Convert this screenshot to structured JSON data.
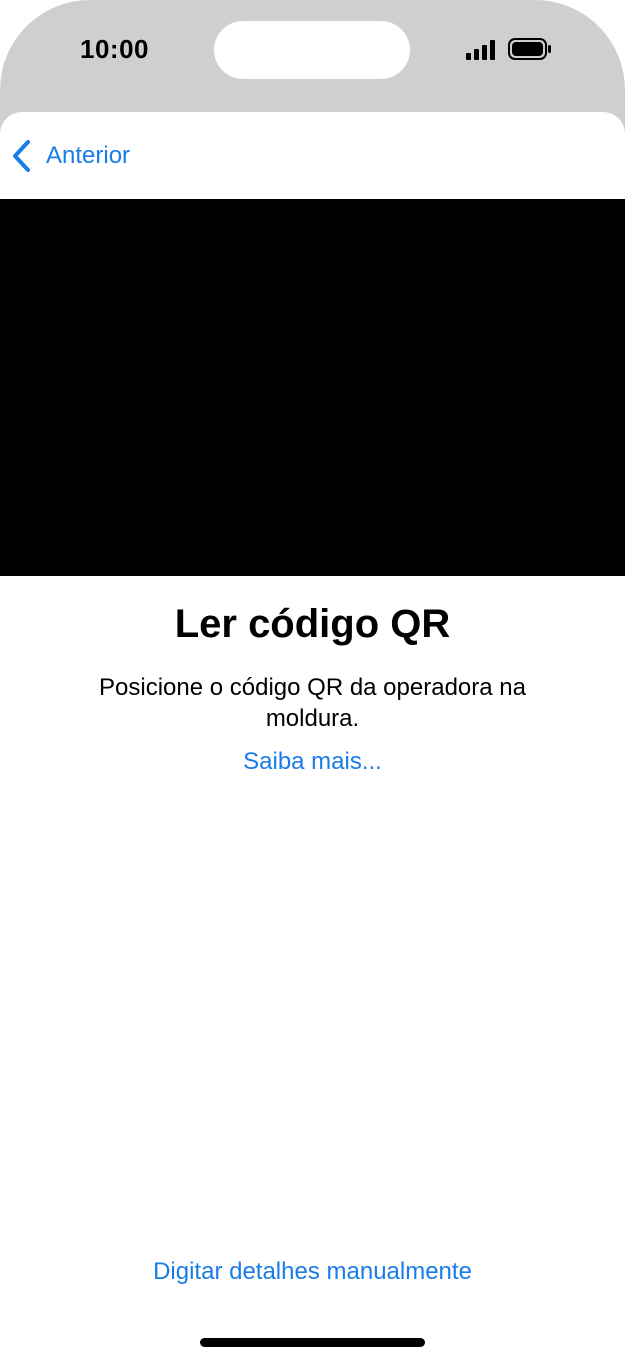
{
  "status_bar": {
    "time": "10:00",
    "signal_icon": "cellular-signal-icon",
    "battery_icon": "battery-icon"
  },
  "nav": {
    "back_label": "Anterior",
    "back_icon": "chevron-left-icon"
  },
  "scanner": {
    "title": "Ler código QR",
    "instructions": "Posicione o código QR da operadora na moldura.",
    "learn_more": "Saiba mais..."
  },
  "footer": {
    "manual_entry": "Digitar detalhes manualmente"
  },
  "colors": {
    "accent": "#1a7ce6",
    "camera_background": "#000000",
    "backdrop": "#cfcfcf"
  }
}
